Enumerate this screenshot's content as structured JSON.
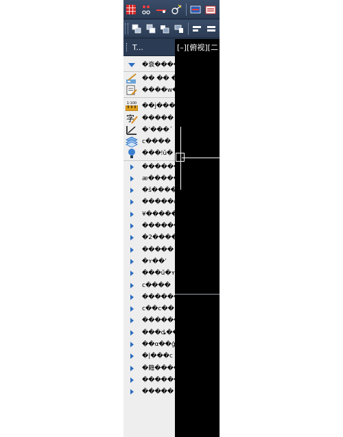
{
  "palette": {
    "title": "T..."
  },
  "viewport": {
    "label": "[–][俯视][二"
  },
  "panel": {
    "header_text": "�衰����",
    "tool_rows": [
      {
        "icon": "brush-icon",
        "text": "�� �� ��"
      },
      {
        "icon": "edit-sheet-icon",
        "text": "����w���"
      },
      {
        "icon": "scale-icon",
        "scale_text": "1:100",
        "text": "��j����"
      },
      {
        "icon": "text-style-icon",
        "text": "�����ˊ"
      },
      {
        "icon": "dimension-icon",
        "text": "�ʼ���ˊ"
      },
      {
        "icon": "layers-icon",
        "text": "c����"
      },
      {
        "icon": "bulb-icon",
        "text": "���ǃǔ�"
      }
    ],
    "collapsed_rows": [
      "�������",
      "æ������",
      "�š�����",
      "�����с�",
      "¥������",
      "�������",
      "�2�����",
      "�����",
      "�ʏ��ʼ",
      "���ű�ʏ",
      "c����",
      "�������",
      "c��c��",
      "�������",
      "���ȡ���",
      "��α��ǵ",
      "�|���c",
      "�籍����",
      "�������",
      "�����ˊ"
    ]
  }
}
